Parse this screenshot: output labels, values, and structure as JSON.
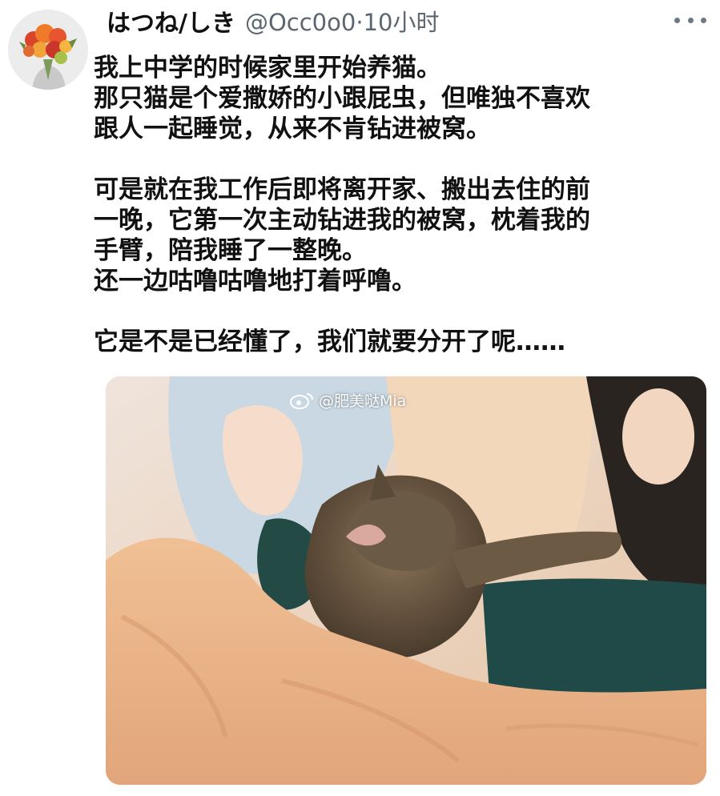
{
  "tweet": {
    "author_name": "はつね/しき",
    "author_handle": "@Occ0o0",
    "separator": "·",
    "time": "10小时",
    "body_lines": [
      "我上中学的时候家里开始养猫。",
      "那只猫是个爱撒娇的小跟屁虫，但唯独不喜欢",
      "跟人一起睡觉，从来不肯钻进被窝。",
      "",
      "可是就在我工作后即将离开家、搬出去住的前",
      "一晚，它第一次主动钻进我的被窝，枕着我的",
      "手臂，陪我睡了一整晚。",
      "还一边咕噜咕噜地打着呼噜。",
      "",
      "它是不是已经懂了，我们就要分开了呢……"
    ],
    "photo_watermark": "@肥美哒Mia"
  },
  "icons": {
    "more": "more-horizontal-icon",
    "avatar": "flower-bouquet-avatar",
    "watermark": "weibo-logo-icon"
  },
  "colors": {
    "text": "#111111",
    "muted": "#5b6671",
    "background": "#ffffff"
  }
}
